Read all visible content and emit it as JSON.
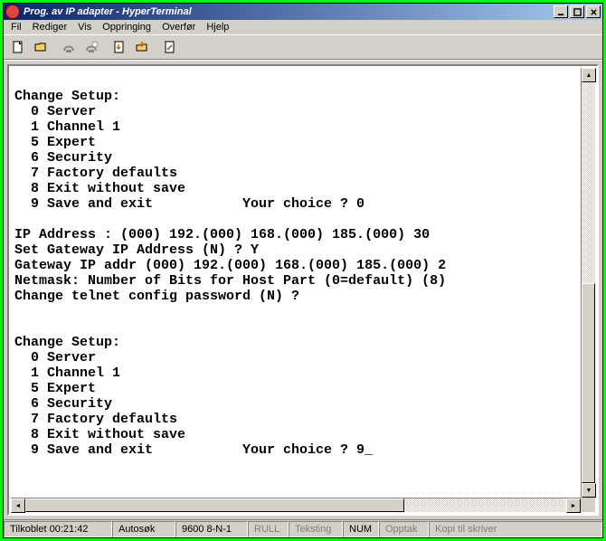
{
  "window": {
    "title": "Prog. av IP adapter - HyperTerminal"
  },
  "menu": {
    "file": "Fil",
    "edit": "Rediger",
    "view": "Vis",
    "call": "Oppringing",
    "transfer": "Overfør",
    "help": "Hjelp"
  },
  "terminal": {
    "lines": [
      "",
      "Change Setup:",
      "  0 Server",
      "  1 Channel 1",
      "  5 Expert",
      "  6 Security",
      "  7 Factory defaults",
      "  8 Exit without save",
      "  9 Save and exit           Your choice ? 0",
      "",
      "IP Address : (000) 192.(000) 168.(000) 185.(000) 30",
      "Set Gateway IP Address (N) ? Y",
      "Gateway IP addr (000) 192.(000) 168.(000) 185.(000) 2",
      "Netmask: Number of Bits for Host Part (0=default) (8)",
      "Change telnet config password (N) ?",
      "",
      "",
      "Change Setup:",
      "  0 Server",
      "  1 Channel 1",
      "  5 Expert",
      "  6 Security",
      "  7 Factory defaults",
      "  8 Exit without save",
      "  9 Save and exit           Your choice ? 9_"
    ]
  },
  "status": {
    "connect": "Tilkoblet 00:21:42",
    "autodetect": "Autosøk",
    "settings": "9600 8-N-1",
    "scroll": "RULL",
    "caps": "Teksting",
    "num": "NUM",
    "capture": "Opptak",
    "print": "Kopi til skriver"
  }
}
